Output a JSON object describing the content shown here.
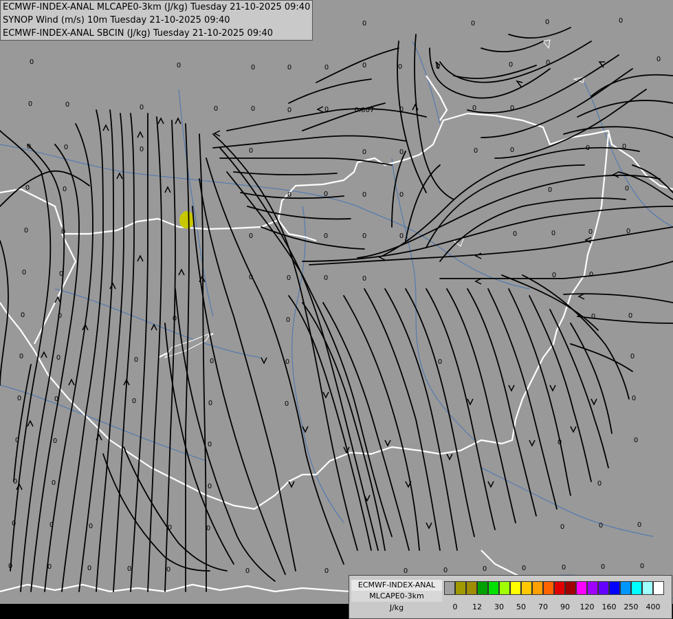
{
  "header": {
    "line1": "ECMWF-INDEX-ANAL MLCAPE0-3km (J/kg) Tuesday 21-10-2025 09:40",
    "line2": "SYNOP Wind (m/s) 10m Tuesday 21-10-2025 09:40",
    "line3": "ECMWF-INDEX-ANAL SBCIN (J/kg) Tuesday 21-10-2025 09:40"
  },
  "legend": {
    "title1": "ECMWF-INDEX-ANAL",
    "title2": "MLCAPE0-3km",
    "unit": "J/kg",
    "colors": [
      "#a0a0a0",
      "#a09a00",
      "#a08c00",
      "#00a000",
      "#00e000",
      "#a0ff00",
      "#ffff00",
      "#ffc800",
      "#ffa000",
      "#ff6400",
      "#e00000",
      "#a00000",
      "#ff00ff",
      "#a000ff",
      "#6400ff",
      "#0000ff",
      "#0096ff",
      "#00ffff",
      "#a0ffff",
      "#ffffff"
    ],
    "ticks": [
      "0",
      "12",
      "30",
      "50",
      "70",
      "90",
      "120",
      "160",
      "250",
      "400"
    ]
  },
  "map": {
    "land_color": "#999999",
    "border_color": "#ffffff",
    "river_color": "#3a6fb8",
    "streamline_color": "#000000",
    "cape_blob_color": "#c8c800",
    "special_value": "0.007",
    "station_value": "0"
  }
}
